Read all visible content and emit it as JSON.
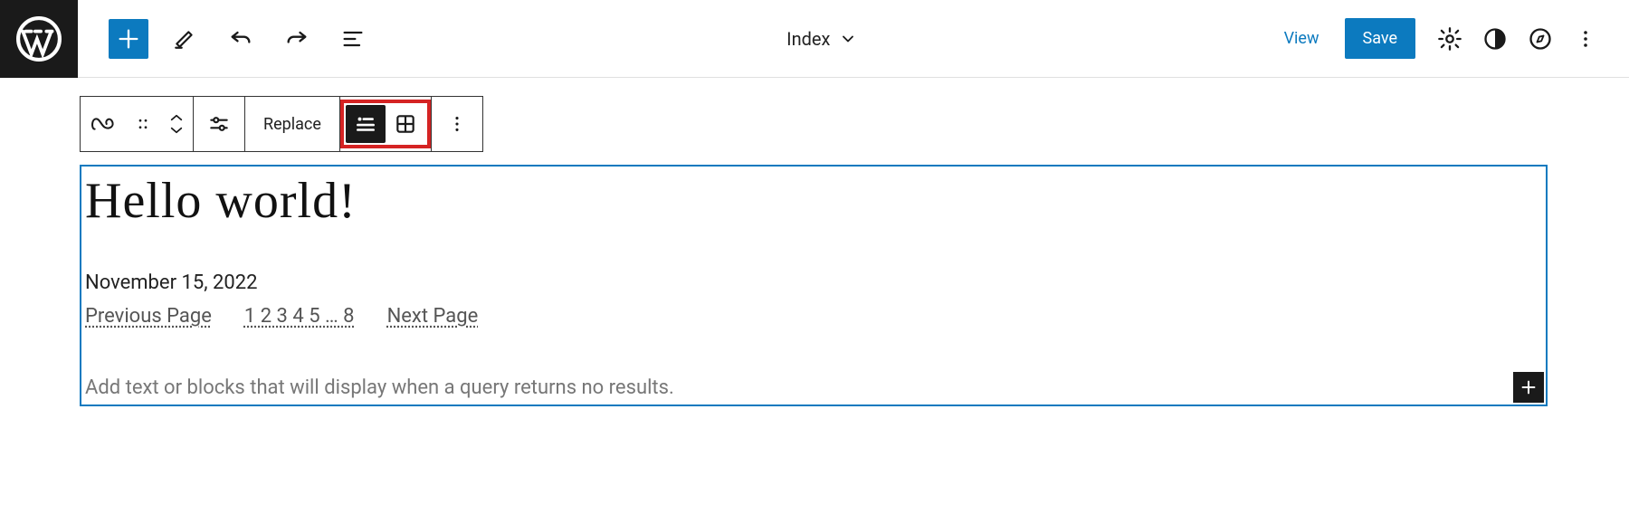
{
  "header": {
    "document_title": "Index",
    "view_label": "View",
    "save_label": "Save"
  },
  "block_toolbar": {
    "replace_label": "Replace"
  },
  "post": {
    "title": "Hello world!",
    "date": "November 15, 2022"
  },
  "pagination": {
    "previous": "Previous Page",
    "pages": "1 2 3 4 5 … 8",
    "next": "Next Page"
  },
  "no_results_placeholder": "Add text or blocks that will display when a query returns no results."
}
